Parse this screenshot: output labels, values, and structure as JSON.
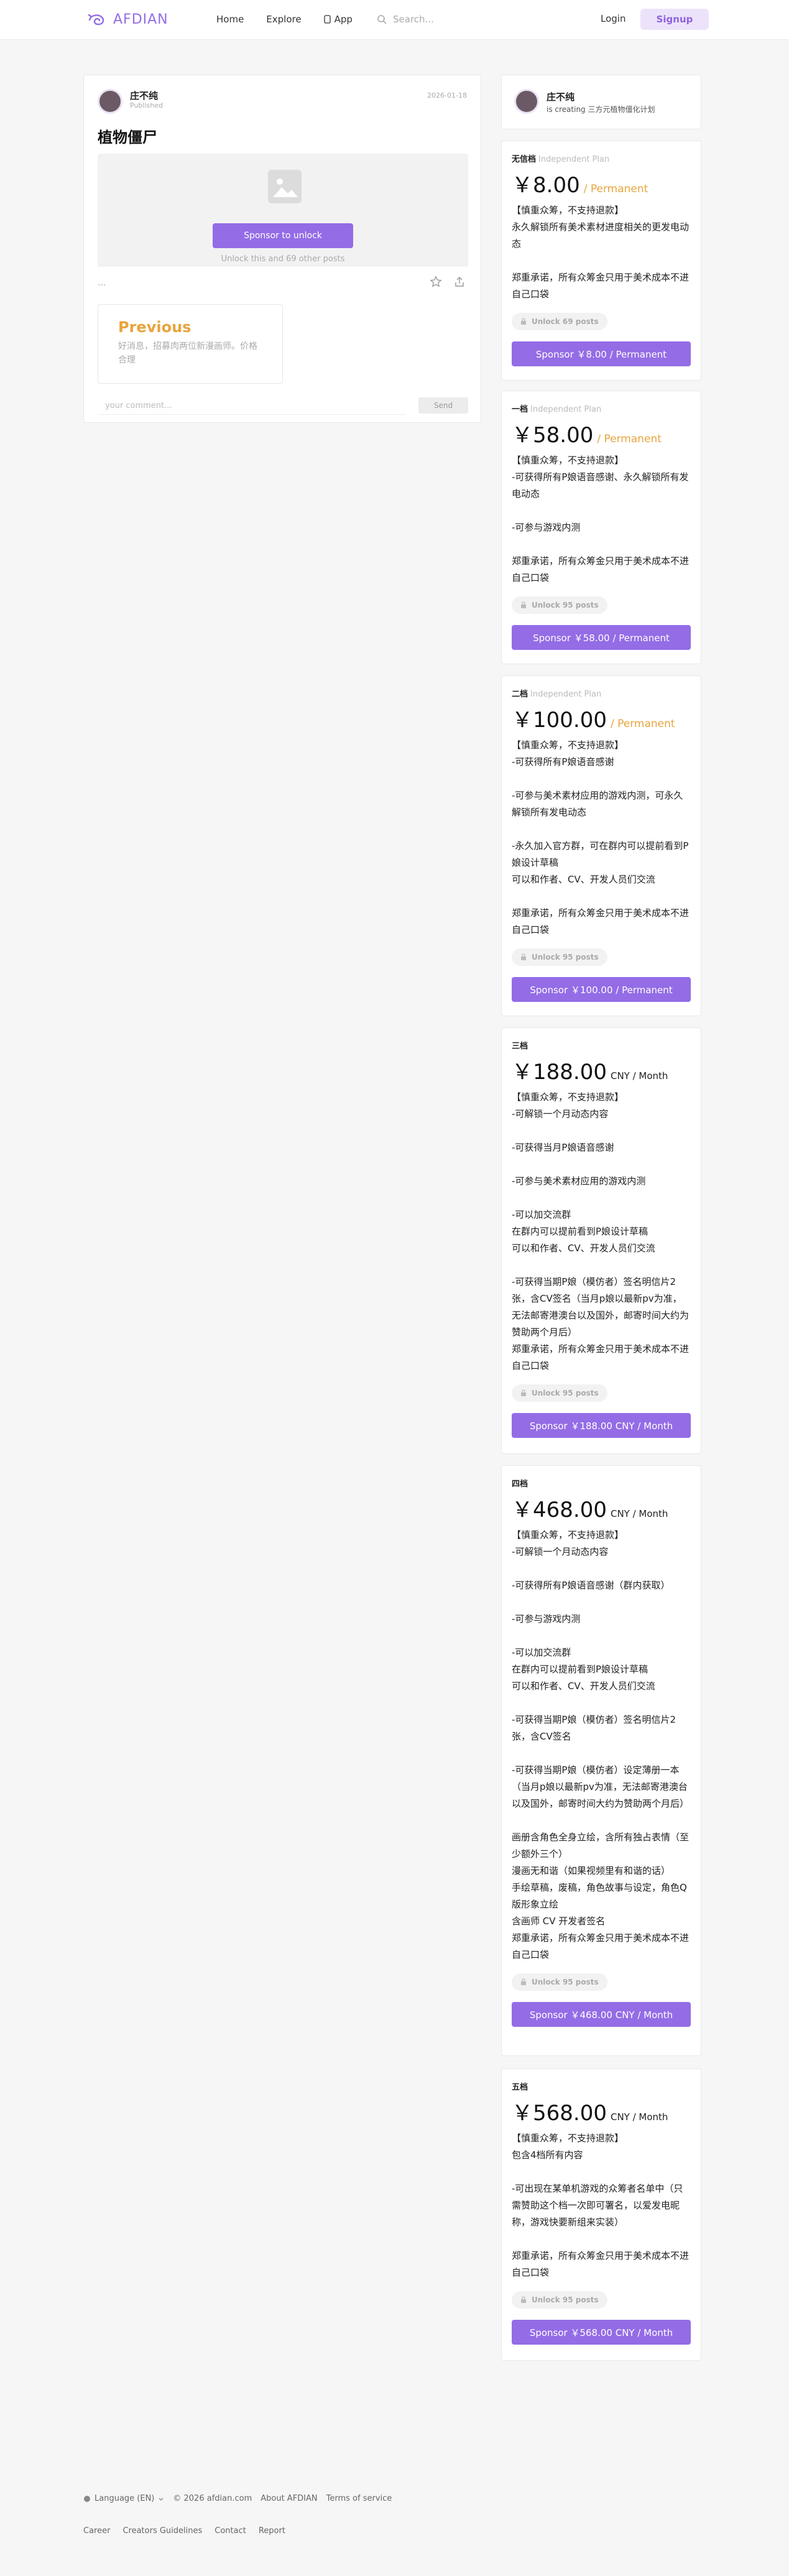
{
  "header": {
    "logo_text": "AFDIAN",
    "nav": [
      {
        "label": "Home"
      },
      {
        "label": "Explore"
      },
      {
        "label": "App"
      }
    ],
    "search_placeholder": "Search...",
    "login": "Login",
    "signup": "Signup"
  },
  "post": {
    "author": "庄不纯",
    "status": "Published",
    "date": "2026-01-18",
    "title": "植物僵尸",
    "unlock_button": "Sponsor to unlock",
    "unlock_note": "Unlock this and 69 other posts",
    "dots": "...",
    "previous_label": "Previous",
    "previous_text": "好消息，招募肉两位新漫画师。价格合理",
    "comment_placeholder": "your comment...",
    "send": "Send"
  },
  "creator": {
    "name": "庄不纯",
    "subtitle": "is creating 三方元植物僵化计划"
  },
  "plans": [
    {
      "name": "无信档",
      "type": "Independent Plan",
      "price": "￥8.00",
      "unit": "/ Permanent",
      "description": "【慎重众筹，不支持退款】\n永久解锁所有美术素材进度相关的更发电动态\n\n郑重承诺，所有众筹金只用于美术成本不进自己口袋",
      "unlock": "Unlock 69 posts",
      "button": "Sponsor ￥8.00 / Permanent"
    },
    {
      "name": "一档",
      "type": "Independent Plan",
      "price": "￥58.00",
      "unit": "/ Permanent",
      "description": "【慎重众筹，不支持退款】\n-可获得所有P娘语音感谢、永久解锁所有发电动态\n\n-可参与游戏内测\n\n郑重承诺，所有众筹金只用于美术成本不进自己口袋",
      "unlock": "Unlock 95 posts",
      "button": "Sponsor ￥58.00 / Permanent"
    },
    {
      "name": "二档",
      "type": "Independent Plan",
      "price": "￥100.00",
      "unit": "/ Permanent",
      "description": "【慎重众筹，不支持退款】\n-可获得所有P娘语音感谢\n\n-可参与美术素材应用的游戏内测，可永久解锁所有发电动态\n\n-永久加入官方群，可在群内可以提前看到P娘设计草稿\n可以和作者、CV、开发人员们交流\n\n郑重承诺，所有众筹金只用于美术成本不进自己口袋",
      "unlock": "Unlock 95 posts",
      "button": "Sponsor ￥100.00 / Permanent"
    },
    {
      "name": "三档",
      "type": "",
      "price": "￥188.00",
      "unit": "CNY / Month",
      "description": "【慎重众筹，不支持退款】\n-可解锁一个月动态内容\n\n-可获得当月P娘语音感谢\n\n-可参与美术素材应用的游戏内测\n\n-可以加交流群\n在群内可以提前看到P娘设计草稿\n可以和作者、CV、开发人员们交流\n\n-可获得当期P娘（模仿者）签名明信片2张，含CV签名（当月p娘以最新pv为准，无法邮寄港澳台以及国外，邮寄时间大约为赞助两个月后）\n郑重承诺，所有众筹金只用于美术成本不进自己口袋",
      "unlock": "Unlock 95 posts",
      "button": "Sponsor ￥188.00 CNY / Month"
    },
    {
      "name": "四档",
      "type": "",
      "price": "￥468.00",
      "unit": "CNY / Month",
      "description": "【慎重众筹，不支持退款】\n-可解锁一个月动态内容\n\n-可获得所有P娘语音感谢（群内获取）\n\n-可参与游戏内测\n\n-可以加交流群\n在群内可以提前看到P娘设计草稿\n可以和作者、CV、开发人员们交流\n\n-可获得当期P娘（模仿者）签名明信片2张，含CV签名\n\n-可获得当期P娘（模仿者）设定薄册一本（当月p娘以最新pv为准，无法邮寄港澳台以及国外，邮寄时间大约为赞助两个月后）\n\n画册含角色全身立绘，含所有独占表情（至少额外三个）\n漫画无和谐（如果视频里有和谐的话）\n手绘草稿，废稿，角色故事与设定，角色Q版形象立绘\n含画师 CV 开发者签名\n郑重承诺，所有众筹金只用于美术成本不进自己口袋",
      "unlock": "Unlock 95 posts",
      "button": "Sponsor ￥468.00 CNY / Month"
    },
    {
      "name": "五档",
      "type": "",
      "price": "￥568.00",
      "unit": "CNY / Month",
      "description": "【慎重众筹，不支持退款】\n包含4档所有内容\n\n-可出现在某单机游戏的众筹者名单中（只需赞助这个档一次即可署名，以爱发电昵称，游戏快要新组来实装）\n\n郑重承诺，所有众筹金只用于美术成本不进自己口袋",
      "unlock": "Unlock 95 posts",
      "button": "Sponsor ￥568.00 CNY / Month"
    }
  ],
  "footer": {
    "language": "Language (EN)",
    "copyright": "© 2026 afdian.com",
    "about": "About AFDIAN",
    "terms": "Terms of service",
    "career": "Career",
    "guidelines": "Creators Guidelines",
    "contact": "Contact",
    "report": "Report"
  },
  "colors": {
    "accent": "#946ce6",
    "accent_light": "#ece3fb",
    "orange": "#e8a43d"
  }
}
